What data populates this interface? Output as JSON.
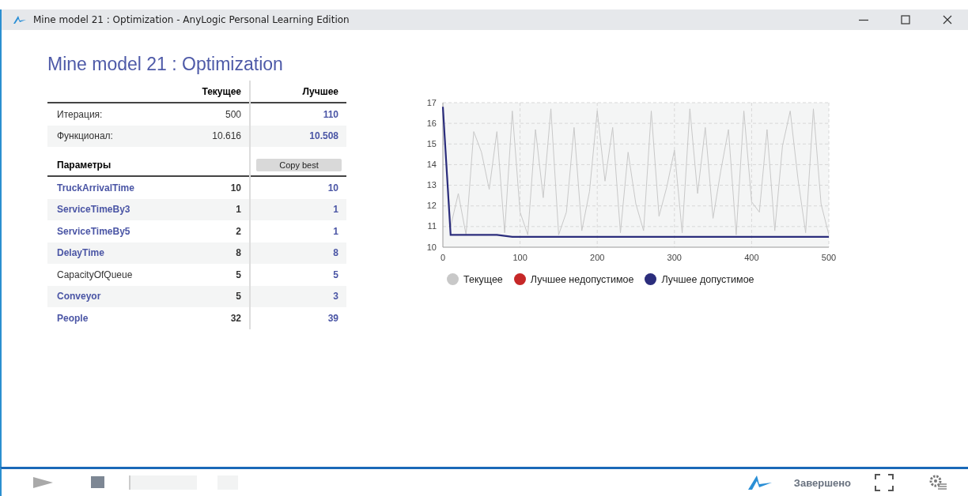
{
  "window": {
    "title": "Mine model 21 : Optimization - AnyLogic Personal Learning Edition"
  },
  "heading": "Mine model 21 : Optimization",
  "summary": {
    "columns": [
      "Текущее",
      "Лучшее"
    ],
    "rows": [
      {
        "label": "Итерация:",
        "current": "500",
        "best": "110"
      },
      {
        "label": "Функционал:",
        "current": "10.616",
        "best": "10.508"
      }
    ]
  },
  "parameters": {
    "heading": "Параметры",
    "copy_button": "Copy best",
    "rows": [
      {
        "name": "TruckArrivalTime",
        "current": "10",
        "best": "10",
        "emphasized": true
      },
      {
        "name": "ServiceTimeBy3",
        "current": "1",
        "best": "1",
        "emphasized": true
      },
      {
        "name": "ServiceTimeBy5",
        "current": "2",
        "best": "1",
        "emphasized": true
      },
      {
        "name": "DelayTime",
        "current": "8",
        "best": "8",
        "emphasized": true
      },
      {
        "name": "CapacityOfQueue",
        "current": "5",
        "best": "5",
        "emphasized": false
      },
      {
        "name": "Conveyor",
        "current": "5",
        "best": "3",
        "emphasized": true
      },
      {
        "name": "People",
        "current": "32",
        "best": "39",
        "emphasized": true
      }
    ]
  },
  "chart": {
    "chart_data": {
      "type": "line",
      "x": [
        0,
        10,
        20,
        30,
        40,
        50,
        60,
        70,
        80,
        90,
        100,
        110,
        120,
        130,
        140,
        150,
        160,
        170,
        180,
        190,
        200,
        210,
        220,
        230,
        240,
        250,
        260,
        270,
        280,
        290,
        300,
        310,
        320,
        330,
        340,
        350,
        360,
        370,
        380,
        390,
        400,
        410,
        420,
        430,
        440,
        450,
        460,
        470,
        480,
        490,
        500
      ],
      "xlim": [
        0,
        500
      ],
      "ylim": [
        10,
        17
      ],
      "xticks": [
        0,
        100,
        200,
        300,
        400,
        500
      ],
      "yticks": [
        10,
        11,
        12,
        13,
        14,
        15,
        16,
        17
      ],
      "grid": true,
      "series": [
        {
          "name": "Текущее",
          "color": "#c8c8c8",
          "values": [
            16.8,
            11.0,
            12.6,
            10.6,
            15.6,
            14.6,
            12.8,
            15.6,
            10.7,
            16.6,
            11.7,
            10.6,
            15.7,
            12.4,
            16.7,
            10.6,
            11.7,
            15.8,
            10.8,
            12.7,
            16.6,
            13.2,
            15.8,
            10.7,
            14.6,
            12.1,
            10.8,
            16.6,
            11.5,
            12.9,
            14.7,
            10.7,
            16.7,
            12.6,
            15.8,
            11.4,
            13.7,
            15.7,
            10.6,
            16.6,
            12.2,
            11.7,
            15.7,
            10.8,
            14.9,
            16.6,
            13.3,
            10.7,
            16.7,
            12.1,
            10.6
          ]
        },
        {
          "name": "Лучшее недопустимое",
          "color": "#c62828",
          "values": [
            null,
            null,
            null,
            null,
            null,
            null,
            null,
            null,
            null,
            null,
            null,
            null,
            null,
            null,
            null,
            null,
            null,
            null,
            null,
            null,
            null,
            null,
            null,
            null,
            null,
            null,
            null,
            null,
            null,
            null,
            null,
            null,
            null,
            null,
            null,
            null,
            null,
            null,
            null,
            null,
            null,
            null,
            null,
            null,
            null,
            null,
            null,
            null,
            null,
            null,
            null
          ]
        },
        {
          "name": "Лучшее допустимое",
          "color": "#2b2d7c",
          "values": [
            16.8,
            10.6,
            10.6,
            10.6,
            10.6,
            10.6,
            10.6,
            10.6,
            10.55,
            10.5,
            10.5,
            10.5,
            10.5,
            10.5,
            10.5,
            10.5,
            10.5,
            10.5,
            10.5,
            10.5,
            10.5,
            10.5,
            10.5,
            10.5,
            10.5,
            10.5,
            10.5,
            10.5,
            10.5,
            10.5,
            10.5,
            10.5,
            10.5,
            10.5,
            10.5,
            10.5,
            10.5,
            10.5,
            10.5,
            10.5,
            10.5,
            10.5,
            10.5,
            10.5,
            10.5,
            10.5,
            10.5,
            10.5,
            10.5,
            10.5,
            10.5
          ]
        }
      ]
    }
  },
  "status_bar": {
    "status": "Завершено"
  }
}
